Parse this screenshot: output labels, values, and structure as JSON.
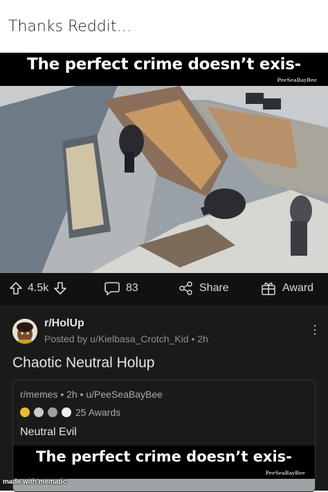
{
  "caption": "Thanks Reddit…",
  "banner": {
    "text": "The perfect crime doesn’t exis-",
    "credit": "PeeSeaBayBee"
  },
  "actions": {
    "upvotes": "4.5k",
    "comments": "83",
    "share_label": "Share",
    "award_label": "Award"
  },
  "post": {
    "subreddit": "r/HolUp",
    "posted_by": "Posted by u/Kielbasa_Crotch_Kid • 2h",
    "title": "Chaotic Neutral Holup",
    "crosspost": {
      "meta": "r/memes • 2h • u/PeeSeaBayBee",
      "awards": "25 Awards",
      "title": "Neutral Evil",
      "banner_text": "The perfect crime doesn’t exis-",
      "banner_credit": "PeeSeaBayBee"
    }
  },
  "watermark": "made with mematic",
  "colors": {
    "background": "#1a1a1b",
    "text": "#e6e6e6",
    "muted": "#8f9194"
  }
}
